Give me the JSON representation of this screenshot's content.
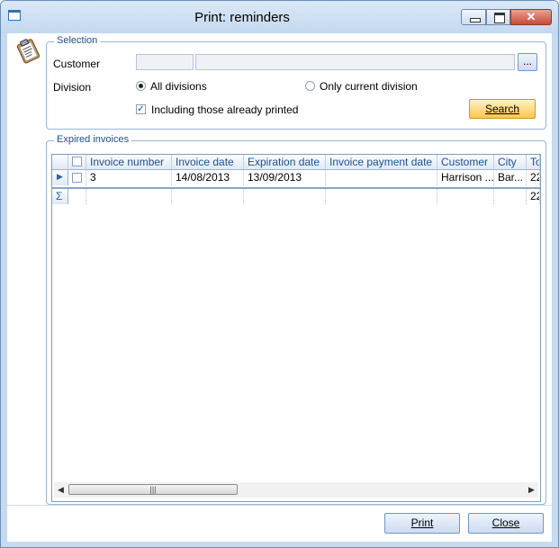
{
  "window": {
    "title": "Print: reminders"
  },
  "selection": {
    "legend": "Selection",
    "customer_label": "Customer",
    "customer_code": "",
    "customer_name": "",
    "browse_label": "...",
    "division_label": "Division",
    "radio_all": "All divisions",
    "radio_current": "Only current division",
    "selected_division": "All divisions",
    "include_printed_label": "Including those already printed",
    "include_printed_checked": true,
    "search_label": "Search"
  },
  "invoices": {
    "legend": "Expired invoices",
    "columns": [
      "Invoice number",
      "Invoice date",
      "Expiration date",
      "Invoice payment date",
      "Customer",
      "City",
      "To"
    ],
    "rows": [
      {
        "invoice_number": "3",
        "invoice_date": "14/08/2013",
        "expiration_date": "13/09/2013",
        "payment_date": "",
        "customer": "Harrison ...",
        "city": "Bar...",
        "total": "22"
      }
    ],
    "summary": {
      "sigma": "Σ",
      "total": "22"
    }
  },
  "buttons": {
    "print": "Print",
    "close": "Close"
  }
}
